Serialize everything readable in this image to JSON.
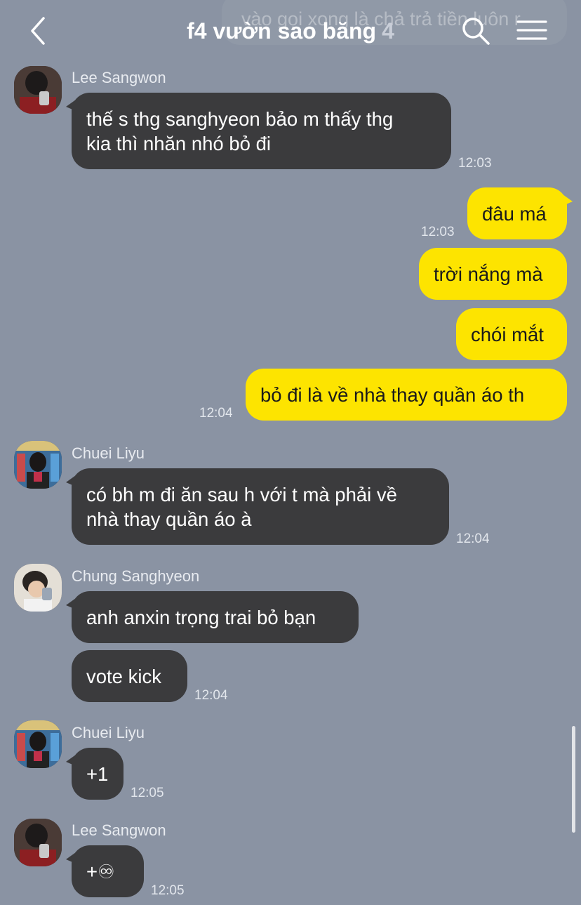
{
  "header": {
    "title": "f4 vườn sao băng",
    "member_count": "4",
    "ghost_preview": "vào gọi xong là chả trả tiền luôn r"
  },
  "messages": [
    {
      "sender": "Lee Sangwon",
      "lines": [
        "thế s thg sanghyeon bảo m thấy thg",
        "kia thì nhăn nhó bỏ đi"
      ],
      "time": "12:03"
    },
    {
      "sender": "me",
      "text": "đâu má",
      "time": "12:03"
    },
    {
      "sender": "me",
      "text": "trời nắng mà"
    },
    {
      "sender": "me",
      "text": "chói mắt"
    },
    {
      "sender": "me",
      "text": "bỏ đi là về nhà thay quần áo th",
      "time": "12:04"
    },
    {
      "sender": "Chuei Liyu",
      "lines": [
        "có bh m đi ăn sau h với t mà phải về",
        "nhà thay quần áo à"
      ],
      "time": "12:04"
    },
    {
      "sender": "Chung Sanghyeon",
      "text": "anh anxin trọng trai bỏ bạn"
    },
    {
      "sender": "Chung Sanghyeon",
      "text": "vote kick",
      "time": "12:04"
    },
    {
      "sender": "Chuei Liyu",
      "text": "+1",
      "time": "12:05"
    },
    {
      "sender": "Lee Sangwon",
      "text": "+♾",
      "time": "12:05"
    }
  ],
  "icons": {
    "back": "chevron-left-icon",
    "search": "search-icon",
    "menu": "hamburger-menu-icon"
  },
  "colors": {
    "background": "#8a93a3",
    "incoming_bubble": "#3b3b3d",
    "outgoing_bubble": "#fde400"
  }
}
